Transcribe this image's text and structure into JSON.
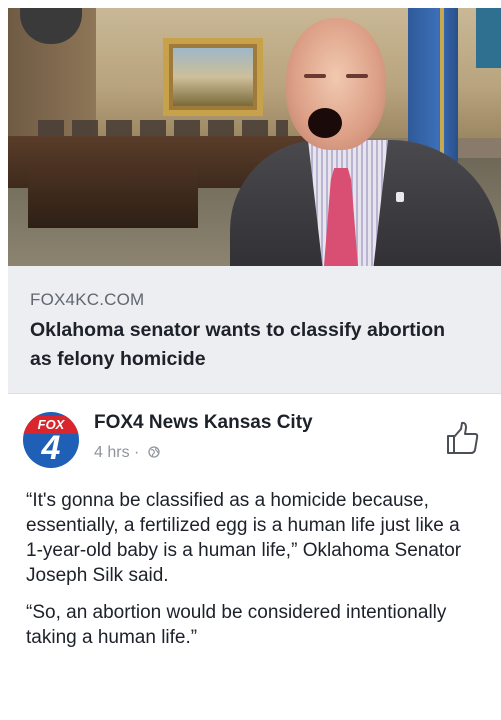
{
  "link_preview": {
    "domain": "FOX4KC.COM",
    "title": "Oklahoma senator wants to classify abortion as felony homicide"
  },
  "post": {
    "page_name": "FOX4 News Kansas City",
    "avatar_band": "FOX",
    "avatar_number": "4",
    "timestamp": "4 hrs",
    "separator": "·",
    "privacy_icon": "globe-icon",
    "like_icon": "thumbs-up-icon",
    "paragraphs": [
      "“It's gonna be classified as a homicide because, essentially, a fertilized egg is a human life just like a 1-year-old baby is a human life,” Oklahoma Senator Joseph Silk said.",
      "“So, an abortion would be considered intentionally taking a human life.”"
    ]
  },
  "colors": {
    "link_bg": "#eceef1",
    "domain_text": "#616770",
    "title_text": "#1d2129",
    "meta_text": "#90949c",
    "avatar_blue": "#1f5fb5",
    "avatar_red": "#d8262c"
  }
}
